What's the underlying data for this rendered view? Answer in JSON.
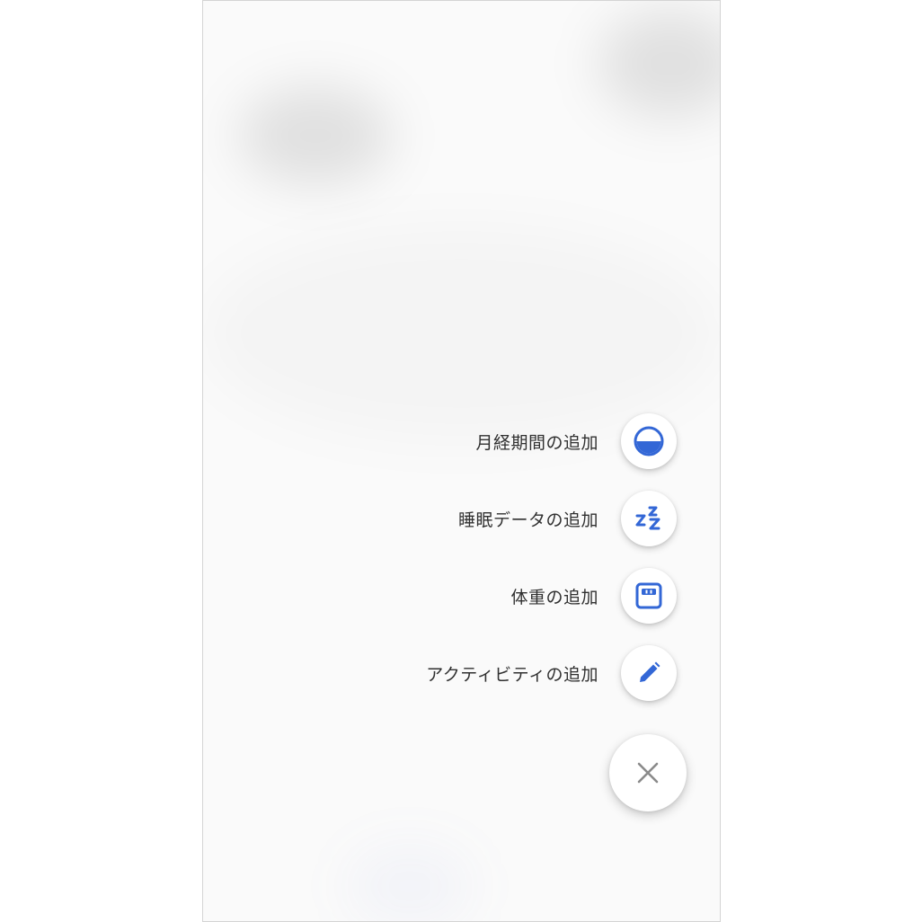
{
  "menu": {
    "items": [
      {
        "label": "月経期間の追加",
        "icon": "half-circle-icon"
      },
      {
        "label": "睡眠データの追加",
        "icon": "sleep-zzz-icon"
      },
      {
        "label": "体重の追加",
        "icon": "scale-icon"
      },
      {
        "label": "アクティビティの追加",
        "icon": "pencil-icon"
      }
    ],
    "close_icon": "close-icon"
  },
  "colors": {
    "accent": "#3367d6",
    "close_icon": "#8a8a8a",
    "label_text": "#303030"
  }
}
